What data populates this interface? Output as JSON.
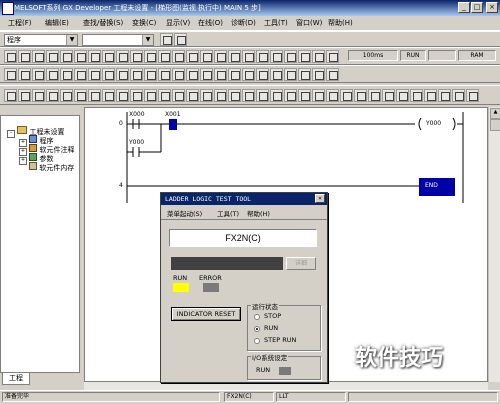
{
  "window": {
    "title": "MELSOFT系列 GX Developer 工程未设置 - [梯形图(监视 执行中)     MAIN   5 步]"
  },
  "menu": [
    "工程(F)",
    "编辑(E)",
    "查找/替换(S)",
    "变换(C)",
    "显示(V)",
    "在线(O)",
    "诊断(D)",
    "工具(T)",
    "窗口(W)",
    "帮助(H)"
  ],
  "toolbar": {
    "combo1_value": "程序",
    "combo2_value": "",
    "status_cells": [
      "100ms",
      "RUN",
      "",
      "RAM"
    ]
  },
  "tree": {
    "root": "工程未设置",
    "items": [
      "程序",
      "软元件注释",
      "参数",
      "软元件内存"
    ],
    "tab": "工程"
  },
  "ladder": {
    "step0": "0",
    "step4": "4",
    "contact1": "X000",
    "contact2": "X001",
    "contact3": "Y000",
    "coil": "Y000",
    "end": "END"
  },
  "dialog": {
    "title": "LADDER LOGIC TEST TOOL",
    "menu": [
      "菜单起动(S)",
      "工具(T)",
      "帮助(H)"
    ],
    "plc": "FX2N(C)",
    "detail_button": "详细",
    "run_label": "RUN",
    "error_label": "ERROR",
    "indicator_button": "INDICATOR RESET",
    "status_group_title": "运行状态",
    "radios": [
      "STOP",
      "RUN",
      "STEP RUN"
    ],
    "selected_radio": "RUN",
    "io_group_title": "I/O系统设定",
    "io_run_label": "RUN"
  },
  "statusbar": {
    "message": "准备完毕",
    "plc": "FX2N(C)",
    "mode": "LLT"
  },
  "watermark": "软件技巧",
  "colors": {
    "run_led": "#ffff00",
    "error_led": "#7a7a7a",
    "cursor": "#0000a8",
    "titlebar": "#0a246a"
  }
}
